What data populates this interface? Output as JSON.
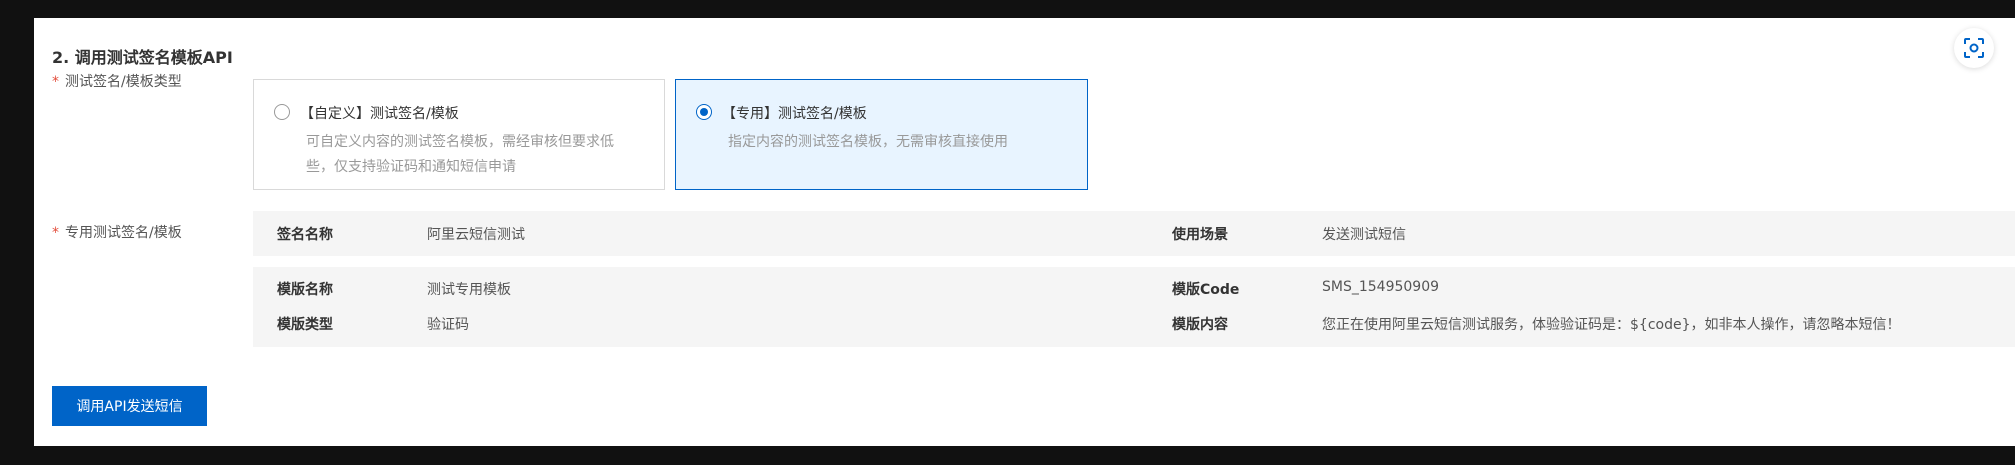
{
  "section": {
    "title": "2. 调用测试签名模板API"
  },
  "form": {
    "type_label": "测试签名/模板类型",
    "required_mark": "*",
    "options": [
      {
        "title": "【自定义】测试签名/模板",
        "desc_line1": "可自定义内容的测试签名模板，需经审核但要求低",
        "desc_line2": "些，仅支持验证码和通知短信申请",
        "selected": false
      },
      {
        "title": "【专用】测试签名/模板",
        "desc_line1": "指定内容的测试签名模板，无需审核直接使用",
        "selected": true
      }
    ],
    "dedicated_label": "专用测试签名/模板"
  },
  "signature": {
    "name_key": "签名名称",
    "name_value": "阿里云短信测试",
    "scene_key": "使用场景",
    "scene_value": "发送测试短信"
  },
  "template": {
    "name_key": "模版名称",
    "name_value": "测试专用模板",
    "code_key": "模版Code",
    "code_value": "SMS_154950909",
    "type_key": "模版类型",
    "type_value": "验证码",
    "content_key": "模版内容",
    "content_value": "您正在使用阿里云短信测试服务，体验验证码是：${code}，如非本人操作，请忽略本短信！"
  },
  "actions": {
    "send_button": "调用API发送短信"
  },
  "icons": {
    "scan": "scan-focus-icon"
  },
  "colors": {
    "primary": "#0064c8",
    "selected_bg": "#e8f4ff",
    "required": "#e34d3b"
  }
}
